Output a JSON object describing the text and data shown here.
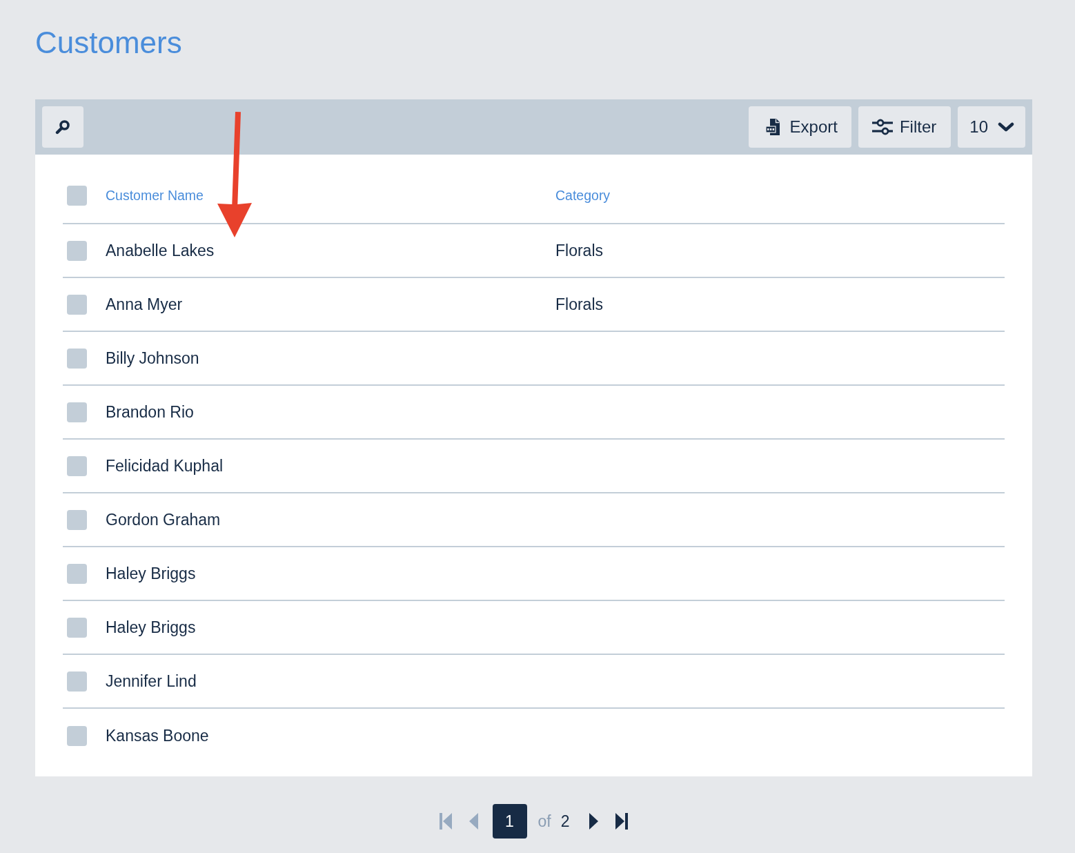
{
  "page": {
    "title": "Customers"
  },
  "toolbar": {
    "actions": [
      {
        "kind": "export",
        "label": "Export"
      },
      {
        "kind": "filter",
        "label": "Filter"
      }
    ],
    "page_size": "10"
  },
  "table": {
    "select_all": {
      "checked": false
    },
    "columns": [
      {
        "label": "Customer Name"
      },
      {
        "label": "Category"
      }
    ],
    "rows": [
      {
        "name": "Anabelle Lakes",
        "category": "Florals",
        "checked": false
      },
      {
        "name": "Anna Myer",
        "category": "Florals",
        "checked": false
      },
      {
        "name": "Billy Johnson",
        "checked": false
      },
      {
        "name": "Brandon Rio",
        "checked": false
      },
      {
        "name": "Felicidad Kuphal",
        "checked": false
      },
      {
        "name": "Gordon Graham",
        "checked": false
      },
      {
        "name": "Haley Briggs",
        "checked": false
      },
      {
        "name": "Haley Briggs",
        "checked": false
      },
      {
        "name": "Jennifer Lind",
        "checked": false
      },
      {
        "name": "Kansas Boone",
        "checked": false
      }
    ]
  },
  "pagination": {
    "first": {
      "disabled": true
    },
    "previous": {
      "disabled": true
    },
    "current_page": "1",
    "separator": "of",
    "total_pages": "2",
    "next": {
      "disabled": false
    },
    "last": {
      "disabled": false
    }
  },
  "annotation": {
    "kind": "arrow"
  }
}
